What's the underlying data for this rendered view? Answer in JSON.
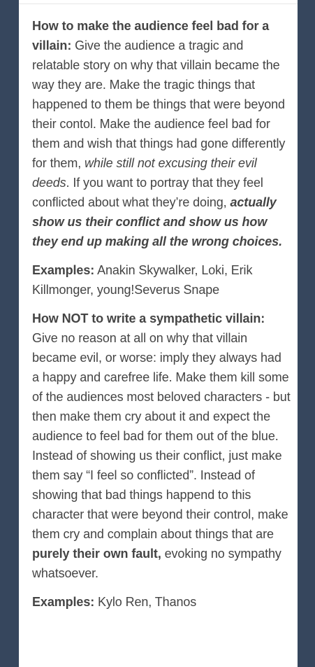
{
  "post": {
    "section1": {
      "heading": "How to make the audience feel bad for a villain:",
      "text1": " Give the audience a tragic and relatable story on why that villain became the way they are. Make the tragic things that happened to them be things that were beyond their contol. Make the audience feel bad for them and wish that things had gone differently for them, ",
      "italic": "while still not excusing their evil deeds",
      "text2": ". If you want to portray that they feel conflicted about what they’re doing, ",
      "bold_italic": "actually show us their conflict and show us how they end up making all the wrong choices."
    },
    "examples1": {
      "label": "Examples:",
      "text": " Anakin Skywalker, Loki, Erik Killmonger, young!Severus Snape"
    },
    "section2": {
      "heading": "How NOT to write a sympathetic villain:",
      "text1": "Give no reason at all on why that villain became evil, or worse: imply they always had a happy and carefree life. Make them kill some of the audiences most beloved characters - but then make them cry about it and expect the audience to feel bad for them out of the blue. Instead of showing us their conflict, just make them say “I feel so conflicted”. Instead of showing that bad things happend to this character that were beyond their control, make them cry and complain about things that are ",
      "bold": "purely their own fault,",
      "text2": " evoking no sympathy whatsoever."
    },
    "examples2": {
      "label": "Examples:",
      "text": " Kylo Ren, Thanos"
    }
  },
  "colors": {
    "background": "#36465d",
    "card": "#ffffff",
    "text": "#444444"
  }
}
